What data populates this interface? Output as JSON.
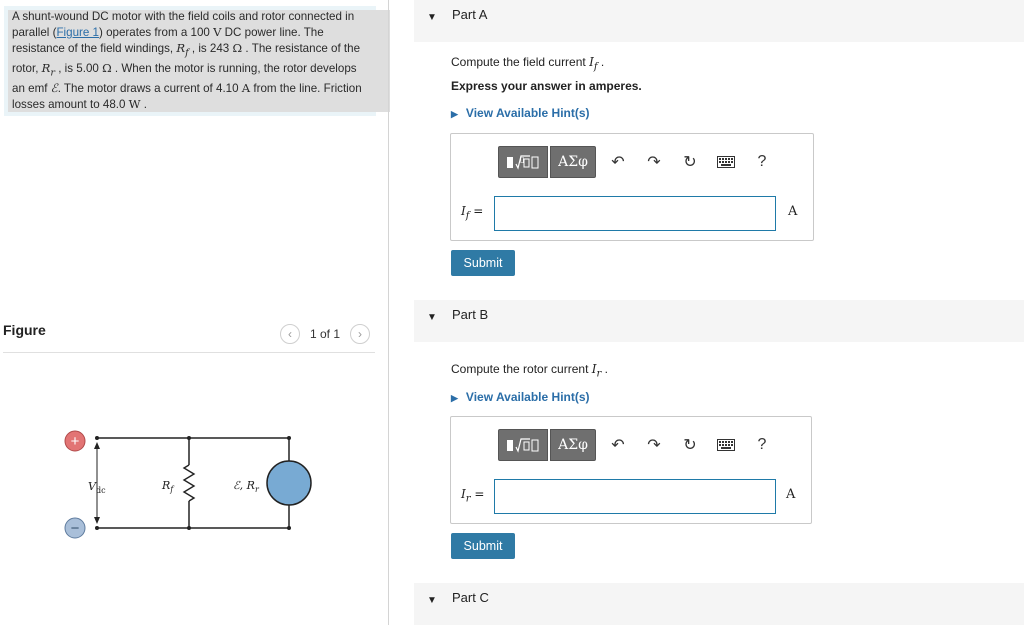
{
  "problem": {
    "t1": "A shunt-wound DC motor with the field coils and rotor connected in parallel (",
    "figure_link": "Figure 1",
    "t2": ") operates from a 100 ",
    "u_v": "V",
    "t3": " DC power line. The resistance of the field windings, ",
    "rf": "R",
    "rf_sub": "f",
    "t4": " , is 243 ",
    "u_ohm1": "Ω",
    "t5": " . The resistance of the rotor, ",
    "rr": "R",
    "rr_sub": "r",
    "t6": " , is 5.00 ",
    "u_ohm2": "Ω",
    "t7": " . When the motor is running, the rotor develops an emf ",
    "emf": "ℰ",
    "t8": ". The motor draws a current of 4.10 ",
    "u_a": "A",
    "t9": " from the line. Friction losses amount to 48.0 ",
    "u_w": "W",
    "t10": " ."
  },
  "figure": {
    "label": "Figure",
    "count": "1 of 1",
    "prev_icon": "chevron-left-icon",
    "next_icon": "chevron-right-icon",
    "circuit": {
      "vdc": "V",
      "vdc_sub": "dc",
      "rf": "R",
      "rf_sub": "f",
      "emf_rr": "ℰ, R",
      "emf_rr_sub": "r",
      "plus": "+",
      "minus": "−"
    }
  },
  "colors": {
    "link": "#2b6ea8",
    "submit": "#2f7aa5",
    "input_border": "#1f7aa8",
    "motor_fill": "#78aad3",
    "plus_fill": "#e27474",
    "minus_fill": "#a9bfd9"
  },
  "parts": {
    "a": {
      "title": "Part A",
      "prompt_pre": "Compute the field current ",
      "prompt_sym": "I",
      "prompt_sub": "f",
      "prompt_post": " .",
      "express": "Express your answer in amperes.",
      "hint": "View Available Hint(s)",
      "label_sym": "I",
      "label_sub": "f",
      "label_eq": " =",
      "unit": "A",
      "submit": "Submit"
    },
    "b": {
      "title": "Part B",
      "prompt_pre": "Compute the rotor current ",
      "prompt_sym": "I",
      "prompt_sub": "r",
      "prompt_post": " .",
      "hint": "View Available Hint(s)",
      "label_sym": "I",
      "label_sub": "r",
      "label_eq": " =",
      "unit": "A",
      "submit": "Submit"
    },
    "c": {
      "title": "Part C"
    }
  },
  "toolbar": {
    "templates_icon": "templates-icon",
    "greek": "ΑΣφ",
    "undo_icon": "undo-icon",
    "redo_icon": "redo-icon",
    "reset_icon": "reset-icon",
    "keyboard_icon": "keyboard-icon",
    "help": "?"
  }
}
